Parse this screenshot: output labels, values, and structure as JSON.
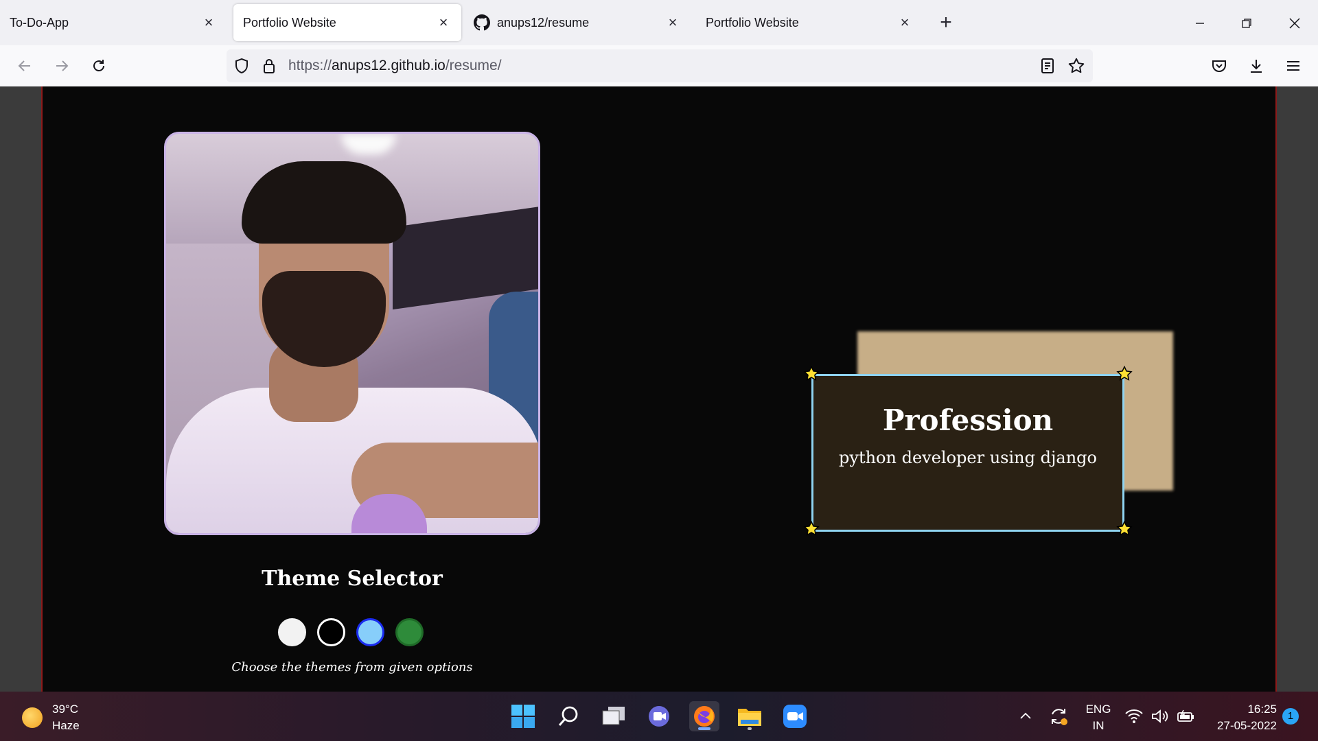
{
  "browser": {
    "tabs": [
      {
        "title": "To-Do-App",
        "active": false
      },
      {
        "title": "Portfolio Website",
        "active": true
      },
      {
        "title": "anups12/resume",
        "active": false,
        "icon": "github-icon"
      },
      {
        "title": "Portfolio Website",
        "active": false
      }
    ],
    "url": {
      "scheme": "https://",
      "host": "anups12.github.io",
      "path": "/resume/"
    }
  },
  "page": {
    "theme_selector": {
      "title": "Theme Selector",
      "hint": "Choose the themes from given options",
      "options": [
        {
          "name": "white-theme",
          "color": "#f2f2f2",
          "border": "#f2f2f2"
        },
        {
          "name": "black-theme",
          "color": "#000000",
          "border": "#ffffff"
        },
        {
          "name": "blue-theme",
          "color": "#87cefa",
          "border": "#1a2cf0"
        },
        {
          "name": "green-theme",
          "color": "#2e8b3a",
          "border": "#1f6b28"
        }
      ]
    },
    "profession_card": {
      "title": "Profession",
      "subtitle": "python developer using django"
    }
  },
  "taskbar": {
    "weather": {
      "temp": "39°C",
      "condition": "Haze"
    },
    "language": {
      "line1": "ENG",
      "line2": "IN"
    },
    "clock": {
      "time": "16:25",
      "date": "27-05-2022"
    },
    "notifications": "1"
  },
  "colors": {
    "accent_border": "#8fd3f0",
    "card_bg": "#2a2114",
    "card_shadow": "#c7ae87",
    "photo_border": "#c9b3e6"
  }
}
